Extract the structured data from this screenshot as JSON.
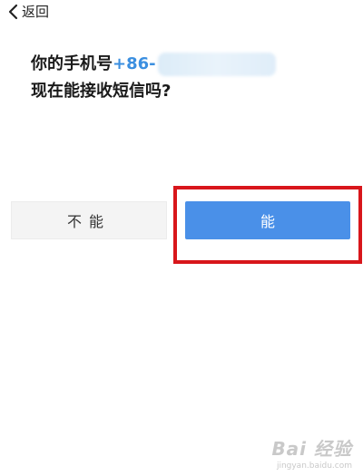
{
  "header": {
    "back_label": "返回",
    "back_icon": "chevron-left-icon"
  },
  "prompt": {
    "line1_text": "你的手机号",
    "phone_prefix": "+86-",
    "line2_text": "现在能接收短信吗?"
  },
  "buttons": {
    "no_label": "不能",
    "yes_label": "能"
  },
  "colors": {
    "accent": "#4a90e8",
    "phone_text": "#3b8fe0",
    "highlight": "#d8161b"
  },
  "watermark": {
    "logo": "Bai 经验",
    "url": "jingyan.baidu.com"
  }
}
